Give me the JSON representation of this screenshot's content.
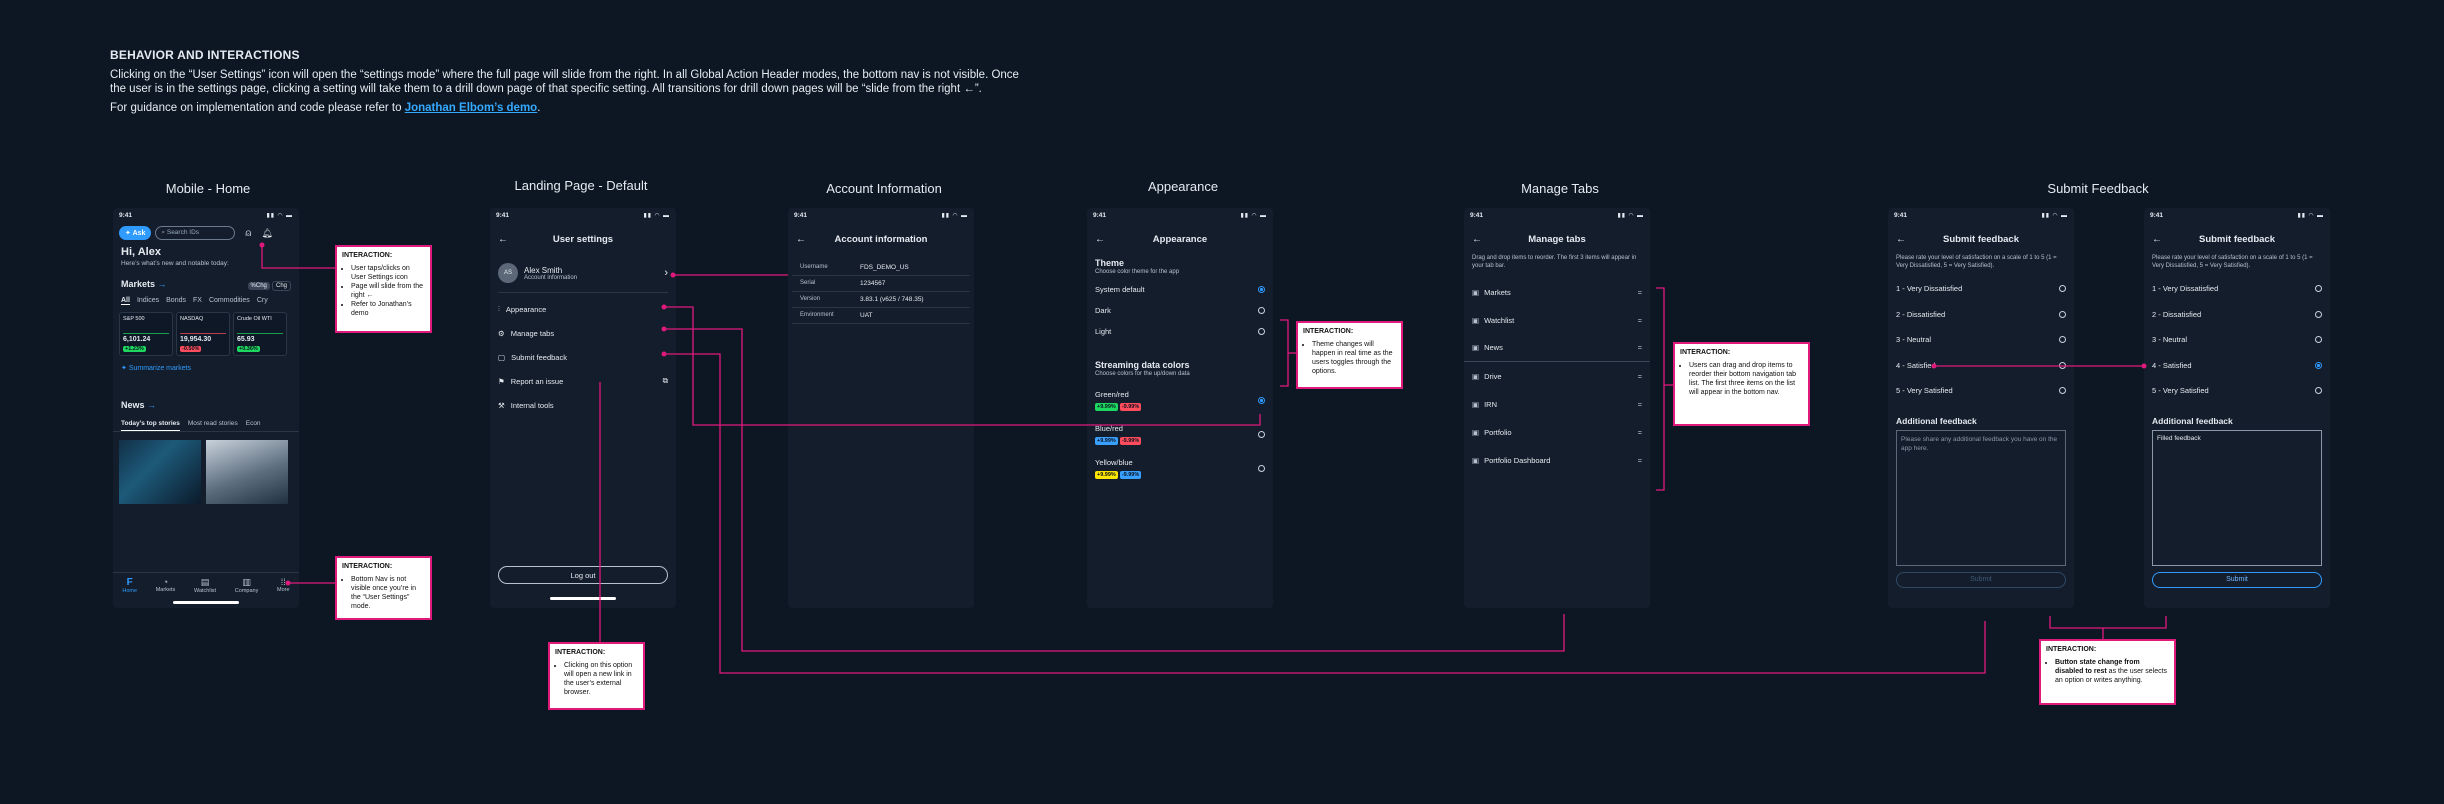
{
  "intro": {
    "title": "BEHAVIOR AND INTERACTIONS",
    "body": "Clicking on the “User Settings” icon will open the “settings mode” where the full page will slide from the right. In all Global Action Header modes, the bottom nav is not visible. Once the user is in the settings page, clicking a setting will take them to a drill down page of that specific setting. All transitions for drill down pages will be “slide from the right ←”.",
    "guide_prefix": "For guidance on implementation and code please refer to ",
    "guide_link": "Jonathan Elbom’s demo",
    "guide_suffix": "."
  },
  "titles": {
    "home": "Mobile - Home",
    "landing": "Landing Page - Default",
    "account": "Account Information",
    "appearance": "Appearance",
    "tabs": "Manage Tabs",
    "feedback": "Submit Feedback"
  },
  "status_time": "9:41",
  "home": {
    "ask": "Ask",
    "search_placeholder": "Search IDs",
    "greeting": "Hi, Alex",
    "subgreeting": "Here’s what’s new and notable today:",
    "markets_label": "Markets",
    "toggle_pct": "%Chg",
    "toggle_chg": "Chg",
    "filters": [
      "All",
      "Indices",
      "Bonds",
      "FX",
      "Commodities",
      "Cry"
    ],
    "cards": [
      {
        "name": "S&P 500",
        "value": "6,101.24",
        "change": "+1.23%",
        "color": "#1ed760"
      },
      {
        "name": "NASDAQ",
        "value": "19,954.30",
        "change": "-0.50%",
        "color": "#ff4d5e"
      },
      {
        "name": "Crude Oil WTI",
        "value": "65.93",
        "change": "+0.36%",
        "color": "#1ed760"
      }
    ],
    "summarize": "Summarize markets",
    "news_label": "News",
    "news_tabs": [
      "Today’s top stories",
      "Most read stories",
      "Econ"
    ],
    "nav": [
      "Home",
      "Markets",
      "Watchlist",
      "Company",
      "More"
    ]
  },
  "landing": {
    "title": "User settings",
    "avatar": "AS",
    "name": "Alex Smith",
    "account_info": "Account information",
    "items": [
      "Appearance",
      "Manage tabs",
      "Submit feedback",
      "Report an issue",
      "Internal tools"
    ],
    "logout": "Log out"
  },
  "account": {
    "title": "Account information",
    "rows": [
      {
        "label": "Username",
        "value": "FDS_DEMO_US"
      },
      {
        "label": "Serial",
        "value": "1234567"
      },
      {
        "label": "Version",
        "value": "3.83.1 (v625 / 748.35)"
      },
      {
        "label": "Environment",
        "value": "UAT"
      }
    ]
  },
  "appearance": {
    "title": "Appearance",
    "theme_heading": "Theme",
    "theme_sub": "Choose color theme for the app",
    "themes": [
      {
        "label": "System default",
        "selected": true
      },
      {
        "label": "Dark",
        "selected": false
      },
      {
        "label": "Light",
        "selected": false
      }
    ],
    "stream_heading": "Streaming data colors",
    "stream_sub": "Choose colors for the up/down data",
    "streams": [
      {
        "label": "Green/red",
        "up": "+9.99%",
        "down": "-9.99%",
        "up_color": "#1ed760",
        "down_color": "#ff4d5e",
        "selected": true
      },
      {
        "label": "Blue/red",
        "up": "+9.99%",
        "down": "-9.99%",
        "up_color": "#3aa0ff",
        "down_color": "#ff4d5e",
        "selected": false
      },
      {
        "label": "Yellow/blue",
        "up": "+9.99%",
        "down": "-9.99%",
        "up_color": "#ffe600",
        "down_color": "#3aa0ff",
        "selected": false
      }
    ]
  },
  "tabs": {
    "title": "Manage tabs",
    "desc": "Drag and drop items to reorder. The first 3 items will appear in your tab bar.",
    "items": [
      "Markets",
      "Watchlist",
      "News",
      "Drive",
      "IRN",
      "Portfolio",
      "Portfolio Dashboard"
    ]
  },
  "feedback": {
    "title": "Submit feedback",
    "desc": "Please rate your level of satisfaction on a scale of 1 to 5 (1 = Very Dissatisfied, 5 = Very Satisfied).",
    "options": [
      "1 - Very Dissatisfied",
      "2 - Dissatisfied",
      "3 - Neutral",
      "4 - Satisfied",
      "5 - Very Satisfied"
    ],
    "additional": "Additional feedback",
    "placeholder": "Please share any additional feedback you have on the app here.",
    "filled": "Filled feedback",
    "submit": "Submit"
  },
  "notes": {
    "heading": "INTERACTION:",
    "settings_icon": [
      "User taps/clicks on User Settings icon",
      "Page will slide from the right ←",
      "Refer to Jonathan’s demo"
    ],
    "bottom_nav": [
      "Bottom Nav is not visible once you’re in the “User Settings” mode."
    ],
    "report": [
      "Clicking on this option will open a new link in the user’s external browser."
    ],
    "theme": [
      "Theme changes will happen in real time as the users toggles through the options."
    ],
    "tabs": [
      "Users can drag and drop items to reorder their bottom navigation tab list. The first three items on the list will appear in the bottom nav."
    ],
    "button_state_bold": "Button state change from disabled to rest",
    "button_state_rest": " as the user selects an option or writes anything."
  },
  "colors": {
    "accent": "#e0197d",
    "link": "#2f9bff",
    "bg": "#0d1723",
    "phone": "#141d2b"
  }
}
